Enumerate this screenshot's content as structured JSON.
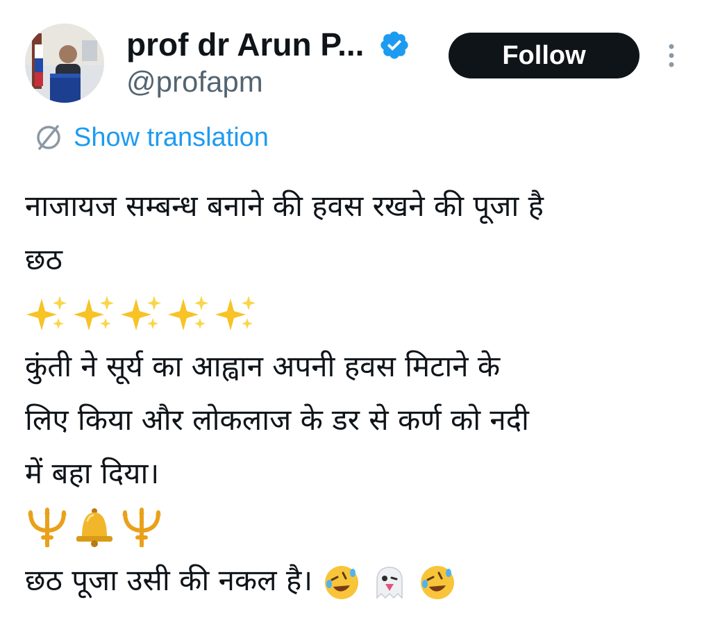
{
  "author": {
    "display_name": "prof dr Arun P...",
    "handle": "@profapm",
    "verified": true
  },
  "follow_label": "Follow",
  "translation_label": "Show translation",
  "tweet": {
    "line1": "नाजायज सम्बन्ध बनाने की हवस रखने की पूजा है",
    "line2": "छठ",
    "sparkles_emoji": [
      "sparkles",
      "sparkles",
      "sparkles",
      "sparkles",
      "sparkles"
    ],
    "line3": "कुंती ने सूर्य का आह्वान अपनी हवस मिटाने के",
    "line4": "लिए किया और लोकलाज के डर से कर्ण को नदी",
    "line5": "में बहा दिया।",
    "middle_emoji": [
      "trident",
      "bell",
      "trident"
    ],
    "line6": "छठ पूजा उसी की नकल है।",
    "ending_emoji": [
      "rolling-on-floor-laughing",
      "ghost",
      "rolling-on-floor-laughing"
    ]
  },
  "colors": {
    "text": "#0f1419",
    "secondary": "#536471",
    "link": "#1d9bf0",
    "follow_bg": "#0f1419",
    "follow_text": "#ffffff",
    "verified": "#1d9bf0"
  }
}
